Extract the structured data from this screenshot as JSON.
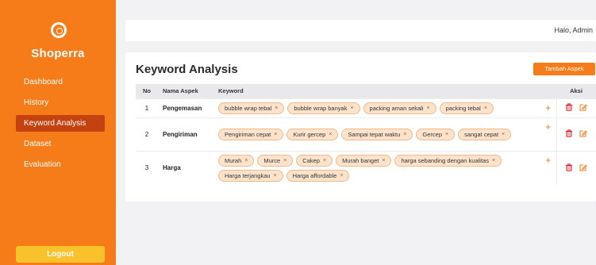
{
  "sidebar": {
    "brand": "Shoperra",
    "items": [
      {
        "label": "Dashboard",
        "active": false
      },
      {
        "label": "History",
        "active": false
      },
      {
        "label": "Keyword Analysis",
        "active": true
      },
      {
        "label": "Dataset",
        "active": false
      },
      {
        "label": "Evaluation",
        "active": false
      }
    ],
    "logout_label": "Logout"
  },
  "header": {
    "greeting": "Halo, Admin"
  },
  "main": {
    "title": "Keyword Analysis",
    "add_button_label": "Tambah Aspek",
    "table": {
      "headers": {
        "no": "No",
        "aspek": "Nama Aspek",
        "keyword": "Keyword",
        "aksi": "Aksi"
      },
      "rows": [
        {
          "no": "1",
          "aspek": "Pengemasan",
          "keywords": [
            "bubble wrap tebal",
            "bubble wrap banyak",
            "packing aman sekali",
            "packing tebal"
          ]
        },
        {
          "no": "2",
          "aspek": "Pengiriman",
          "keywords": [
            "Pengiriman cepat",
            "Kurir gercep",
            "Sampai tepat waktu",
            "Gercep",
            "sangat cepat"
          ]
        },
        {
          "no": "3",
          "aspek": "Harga",
          "keywords": [
            "Murah",
            "Murce",
            "Cakep",
            "Murah banget",
            "harga sebanding dengan kualitas",
            "Harga terjangkau",
            "Harga affordable"
          ]
        }
      ]
    },
    "chip_remove_glyph": "×",
    "add_keyword_glyph": "+"
  },
  "colors": {
    "accent": "#f57c18",
    "active_nav": "#c3420f",
    "logout": "#f9c22a",
    "chip_bg": "#fde3cc",
    "delete": "#e0242f"
  }
}
